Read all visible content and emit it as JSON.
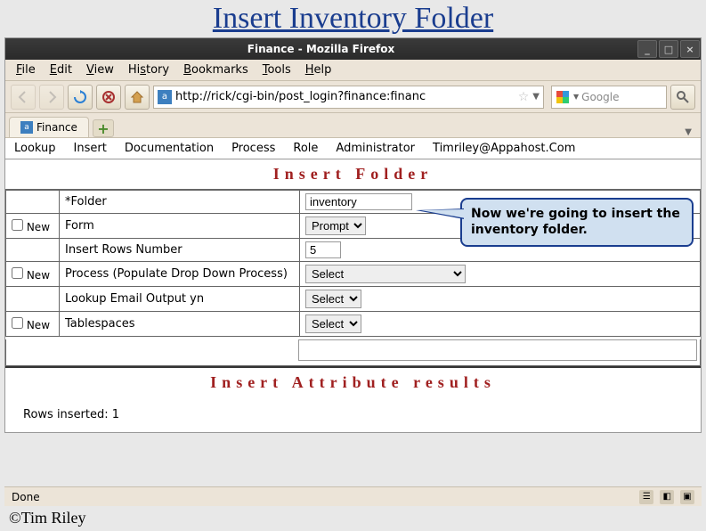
{
  "slide_title": "Insert Inventory Folder",
  "window_title": "Finance - Mozilla Firefox",
  "menubar": {
    "file": "File",
    "edit": "Edit",
    "view": "View",
    "history": "History",
    "bookmarks": "Bookmarks",
    "tools": "Tools",
    "help": "Help"
  },
  "url": "http://rick/cgi-bin/post_login?finance:financ",
  "search_placeholder": "Google",
  "tab_label": "Finance",
  "page_nav": {
    "lookup": "Lookup",
    "insert": "Insert",
    "documentation": "Documentation",
    "process": "Process",
    "role": "Role",
    "admin": "Administrator",
    "email": "Timriley@Appahost.Com"
  },
  "section_insert": "Insert Folder",
  "form": {
    "new_label": "New",
    "folder_label": "*Folder",
    "folder_value": "inventory",
    "form_label": "Form",
    "form_select": "Prompt",
    "rows_label": "Insert Rows Number",
    "rows_value": "5",
    "process_label": "Process (Populate Drop Down Process)",
    "process_select": "Select",
    "email_label": "Lookup Email Output yn",
    "email_select": "Select",
    "tablespaces_label": "Tablespaces",
    "tablespaces_select": "Select"
  },
  "section_results": "Insert Attribute results",
  "results_msg": "Rows inserted: 1",
  "status": "Done",
  "callout": "Now we're going to insert the inventory folder.",
  "copyright": "©Tim Riley"
}
